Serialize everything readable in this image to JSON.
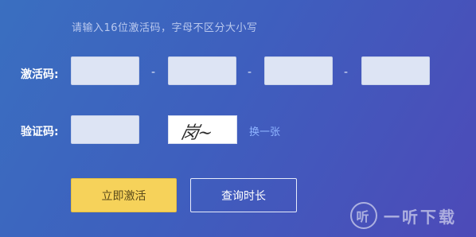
{
  "hint": "请输入16位激活码，字母不区分大小写",
  "activation": {
    "label": "激活码:",
    "separator": "-",
    "fields": [
      "",
      "",
      "",
      ""
    ]
  },
  "verification": {
    "label": "验证码:",
    "field_value": "",
    "captcha_text": "岗~",
    "refresh_label": "换一张"
  },
  "buttons": {
    "activate_label": "立即激活",
    "query_label": "查询时长"
  },
  "watermark": {
    "logo_char": "听",
    "text": "一听下载"
  },
  "colors": {
    "accent_yellow": "#f6d25a",
    "link_blue": "#8fb4ff",
    "background_start": "#3a6fc0",
    "background_end": "#4d4ab8"
  }
}
